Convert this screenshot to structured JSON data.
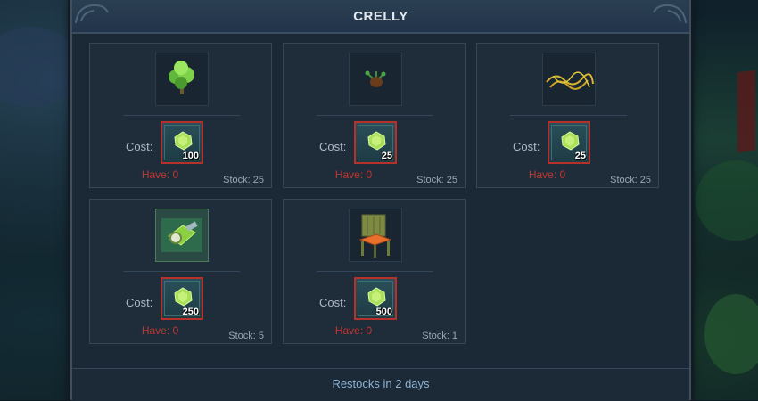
{
  "window": {
    "title": "CRELLY"
  },
  "currency_icon": "green-gem-icon",
  "items": [
    {
      "icon": "green-shrub-icon",
      "cost_label": "Cost:",
      "amount": "100",
      "have": "Have: 0",
      "stock": "Stock: 25"
    },
    {
      "icon": "small-plant-seed-icon",
      "cost_label": "Cost:",
      "amount": "25",
      "have": "Have: 0",
      "stock": "Stock: 25"
    },
    {
      "icon": "yellow-vine-icon",
      "cost_label": "Cost:",
      "amount": "25",
      "have": "Have: 0",
      "stock": "Stock: 25"
    },
    {
      "icon": "green-device-icon",
      "cost_label": "Cost:",
      "amount": "250",
      "have": "Have: 0",
      "stock": "Stock: 5"
    },
    {
      "icon": "wooden-chair-icon",
      "cost_label": "Cost:",
      "amount": "500",
      "have": "Have: 0",
      "stock": "Stock: 1"
    }
  ],
  "footer": {
    "restock_text": "Restocks in 2 days"
  },
  "colors": {
    "have_text": "#c0362e",
    "cost_border": "#b8302a",
    "footer_text": "#8fb3d3"
  }
}
